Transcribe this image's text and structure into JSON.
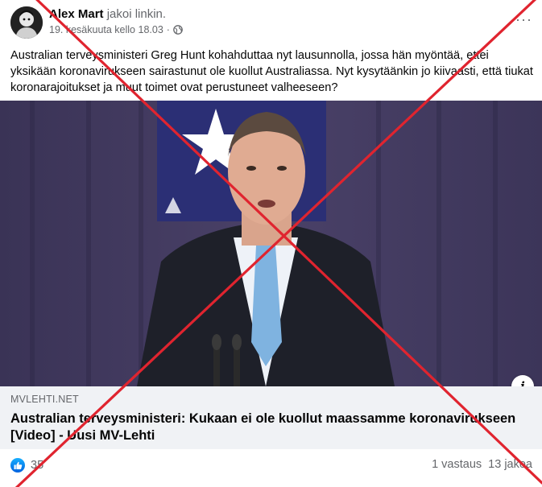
{
  "post": {
    "author_name": "Alex Mart",
    "author_action": "jakoi linkin.",
    "timestamp": "19. kesäkuuta kello 18.03",
    "separator": "·",
    "privacy_icon": "globe-icon",
    "more_label": "···",
    "text": "Australian terveysministeri Greg Hunt kohahduttaa nyt lausunnolla, jossa hän myöntää, ettei yksikään koronavirukseen sairastunut ole kuollut Australiassa. Nyt kysytäänkin jo kiivaasti, että tiukat koronarajoitukset ja muut toimet ovat perustuneet valheeseen?"
  },
  "link": {
    "domain": "MVLEHTI.NET",
    "title": "Australian terveysministeri: Kukaan ei ole kuollut maassamme koronavirukseen [Video] - Uusi MV-Lehti",
    "info_label": "i"
  },
  "stats": {
    "reaction_icon": "like-icon",
    "reaction_count": "35",
    "comments": "1 vastaus",
    "shares": "13 jakoa"
  },
  "overlay": {
    "cross_color": "#e0242f"
  }
}
